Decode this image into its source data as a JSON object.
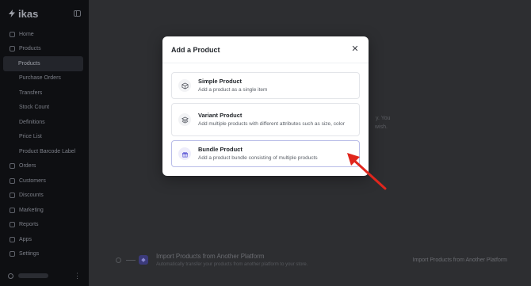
{
  "sidebar": {
    "logo_text": "ikas",
    "items": [
      {
        "label": "Home",
        "icon": "home-icon"
      },
      {
        "label": "Products",
        "icon": "box-icon"
      },
      {
        "label": "Products",
        "sub": true,
        "active": true
      },
      {
        "label": "Purchase Orders",
        "sub": true
      },
      {
        "label": "Transfers",
        "sub": true
      },
      {
        "label": "Stock Count",
        "sub": true
      },
      {
        "label": "Definitions",
        "sub": true
      },
      {
        "label": "Price List",
        "sub": true
      },
      {
        "label": "Product Barcode Label",
        "sub": true
      },
      {
        "label": "Orders",
        "icon": "cart-icon"
      },
      {
        "label": "Customers",
        "icon": "users-icon"
      },
      {
        "label": "Discounts",
        "icon": "tag-icon"
      },
      {
        "label": "Marketing",
        "icon": "megaphone-icon"
      },
      {
        "label": "Reports",
        "icon": "chart-icon"
      },
      {
        "label": "Apps",
        "icon": "grid-icon"
      },
      {
        "label": "Settings",
        "icon": "gear-icon"
      }
    ]
  },
  "background": {
    "ghost_text_1": "y. You",
    "ghost_text_2": "wish.",
    "import_title": "Import Products from Another Platform",
    "import_desc": "Automatically transfer your products from another platform to your store.",
    "import_link": "Import Products from Another Platform"
  },
  "modal": {
    "title": "Add a Product",
    "close_label": "✕",
    "options": [
      {
        "title": "Simple Product",
        "desc": "Add a product as a single item",
        "icon": "cube-icon"
      },
      {
        "title": "Variant Product",
        "desc": "Add multiple products with different attributes such as size, color",
        "icon": "layers-icon"
      },
      {
        "title": "Bundle Product",
        "desc": "Add a product bundle consisting of multiple products",
        "icon": "gift-icon"
      }
    ]
  },
  "colors": {
    "accent": "#5b57d6",
    "arrow": "#e0261d"
  }
}
